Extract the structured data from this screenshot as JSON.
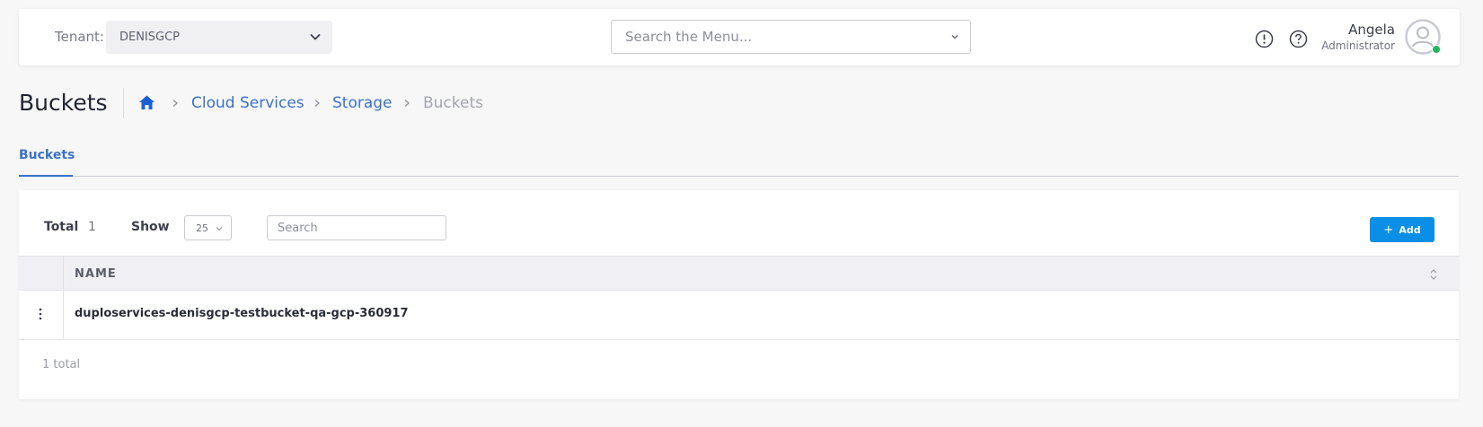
{
  "header": {
    "tenant_label": "Tenant:",
    "tenant_value": "DENISGCP",
    "menu_search_placeholder": "Search the Menu...",
    "user_name": "Angela",
    "user_role": "Administrator",
    "status_color": "#22b75a"
  },
  "page": {
    "title": "Buckets",
    "breadcrumb": [
      "Cloud Services",
      "Storage",
      "Buckets"
    ]
  },
  "tabs": [
    {
      "label": "Buckets",
      "active": true
    }
  ],
  "table": {
    "total_label": "Total",
    "total_value": "1",
    "show_label": "Show",
    "page_size": "25",
    "search_placeholder": "Search",
    "add_label": "Add",
    "add_icon": "+",
    "columns": [
      "NAME"
    ],
    "rows": [
      {
        "name": "duploservices-denisgcp-testbucket-qa-gcp-360917"
      }
    ],
    "footer_total": "1 total"
  },
  "colors": {
    "accent": "#3b72c8",
    "button": "#0b8fe6"
  }
}
